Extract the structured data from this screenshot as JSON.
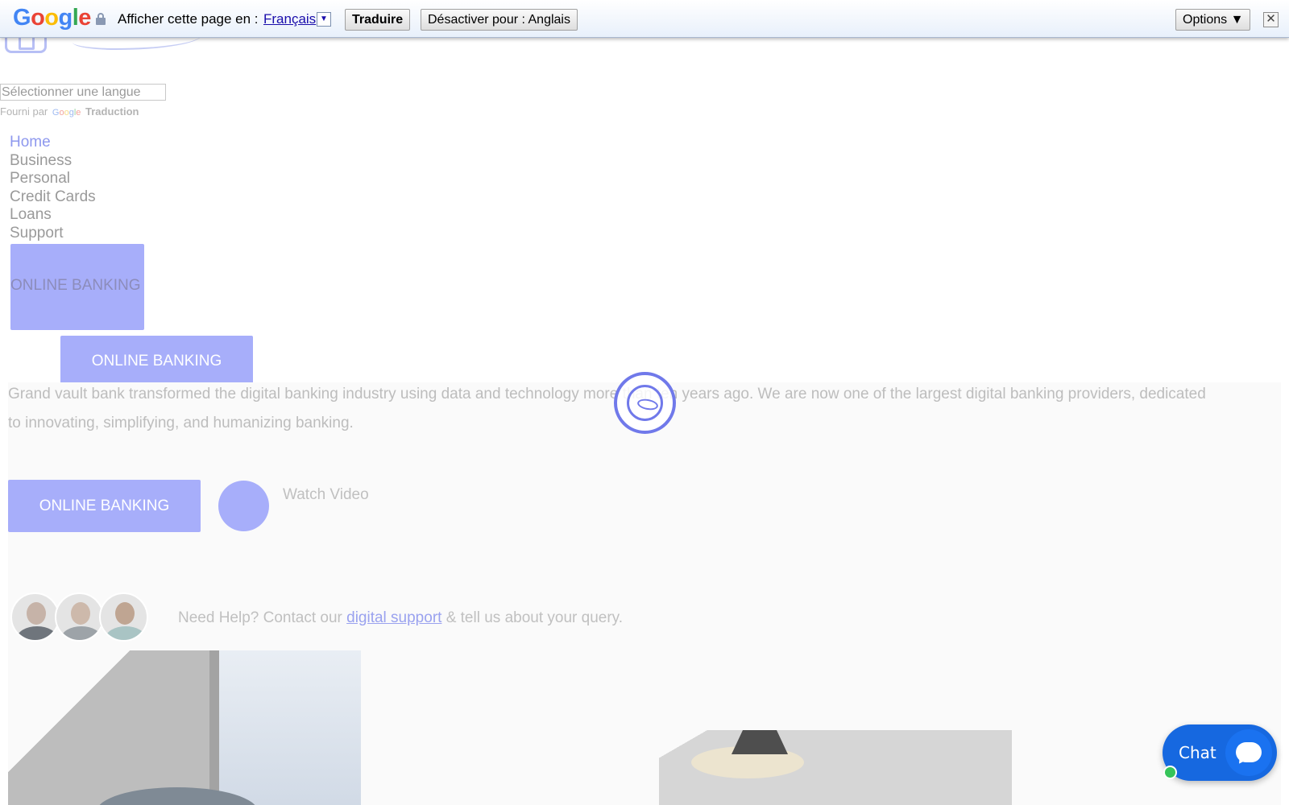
{
  "translate_bar": {
    "logo_letters": [
      "G",
      "o",
      "o",
      "g",
      "l",
      "e"
    ],
    "prompt_text": "Afficher cette page en :",
    "language": "Français",
    "translate_button": "Traduire",
    "disable_button": "Désactiver pour : Anglais",
    "options_button": "Options ▼",
    "close_glyph": "✕",
    "dropdown_glyph": "▼"
  },
  "language_widget": {
    "select_value": "Sélectionner une langue",
    "powered_by": "Fourni par",
    "google_letters": [
      "G",
      "o",
      "o",
      "g",
      "l",
      "e"
    ],
    "translate_label": "Traduction"
  },
  "nav": {
    "items": [
      {
        "label": "Home",
        "active": true
      },
      {
        "label": "Business",
        "active": false
      },
      {
        "label": "Personal",
        "active": false
      },
      {
        "label": "Credit Cards",
        "active": false
      },
      {
        "label": "Loans",
        "active": false
      },
      {
        "label": "Support",
        "active": false
      }
    ]
  },
  "online_banking": {
    "label_box": "ONLINE BANKING",
    "label_button_2": "ONLINE BANKING",
    "label_button_3": "ONLINE BANKING"
  },
  "hero": {
    "description_line_1": "Grand vault bank transformed the digital banking industry using data and technology more than ten years ago. We are now one of the largest digital banking providers, dedicated",
    "description_line_2": "to innovating, simplifying, and humanizing banking.",
    "watch_video": "Watch Video"
  },
  "help": {
    "prefix": "Need Help? Contact our",
    "link": "digital support",
    "suffix": "& tell us about your query."
  },
  "chat": {
    "label": "Chat"
  },
  "colors": {
    "accent": "#a7aefa",
    "loader": "#7079ea",
    "chat_blue": "#1668e0",
    "online_dot": "#36c45a"
  },
  "icons": [
    "lock-icon",
    "dropdown-arrow-icon",
    "close-icon",
    "loading-spinner-icon",
    "play-video-icon",
    "chat-bubble-icon"
  ]
}
